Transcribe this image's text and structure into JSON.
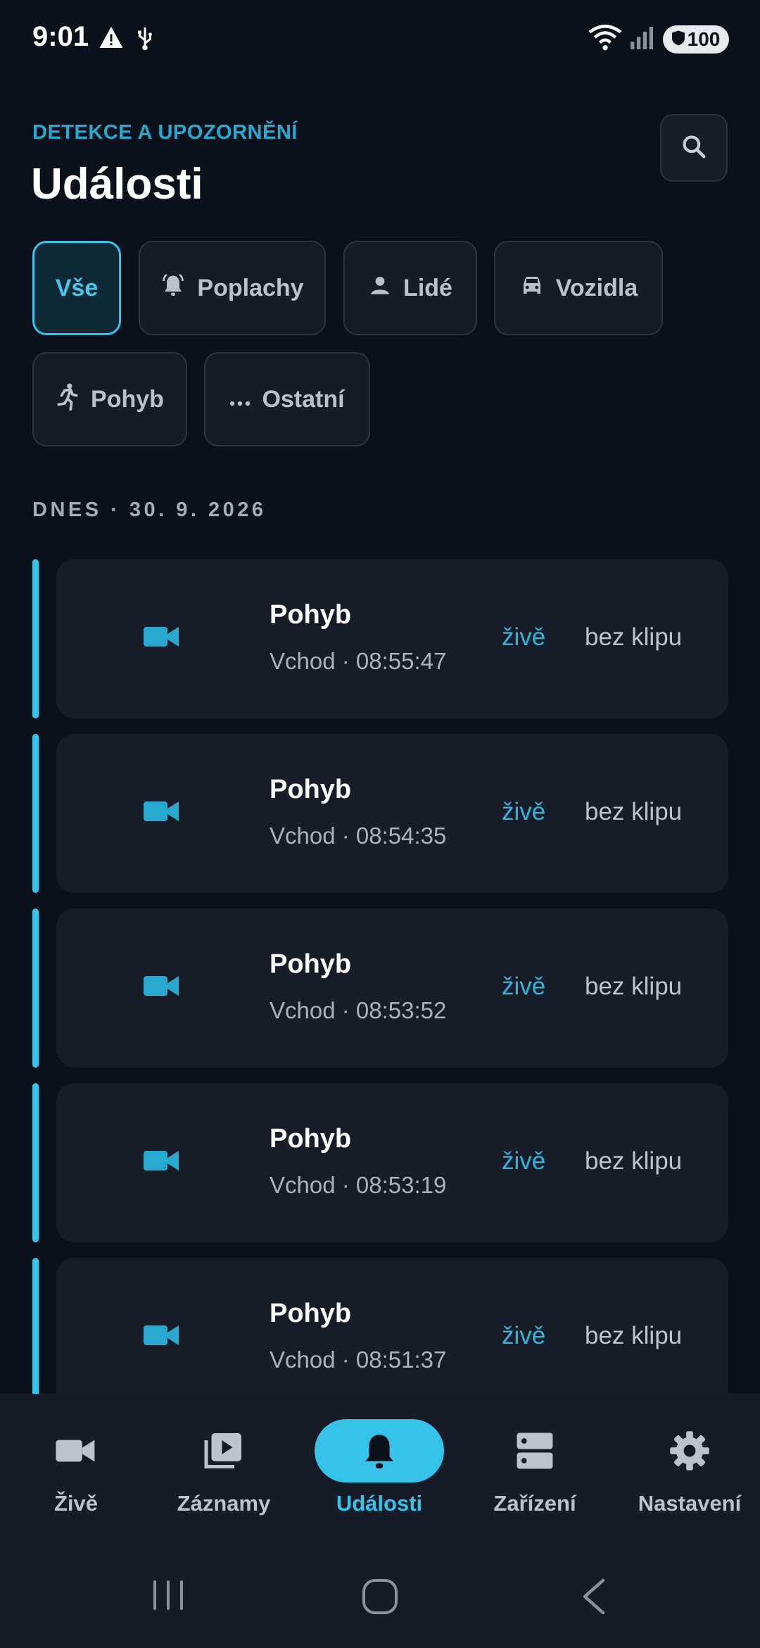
{
  "status_bar": {
    "time": "9:01",
    "battery": "100",
    "icons": [
      "warning-icon",
      "usb-icon",
      "wifi-icon",
      "signal-icon",
      "battery-icon"
    ]
  },
  "header": {
    "eyebrow": "DETEKCE A UPOZORNĚNÍ",
    "title": "Události",
    "search_icon": "search-icon"
  },
  "filters": [
    {
      "label": "Vše",
      "icon": "",
      "active": true
    },
    {
      "label": "Poplachy",
      "icon": "alarm-bell-icon",
      "active": false
    },
    {
      "label": "Lidé",
      "icon": "person-icon",
      "active": false
    },
    {
      "label": "Vozidla",
      "icon": "car-icon",
      "active": false
    },
    {
      "label": "Pohyb",
      "icon": "running-person-icon",
      "active": false
    },
    {
      "label": "Ostatní",
      "icon": "more-dots-icon",
      "active": false
    }
  ],
  "date_label": "DNES · 30. 9. 2026",
  "events": [
    {
      "title": "Pohyb",
      "subtitle": "Vchod · 08:55:47",
      "live": "živě",
      "clip": "bez klipu",
      "icon": "video-camera-icon"
    },
    {
      "title": "Pohyb",
      "subtitle": "Vchod · 08:54:35",
      "live": "živě",
      "clip": "bez klipu",
      "icon": "video-camera-icon"
    },
    {
      "title": "Pohyb",
      "subtitle": "Vchod · 08:53:52",
      "live": "živě",
      "clip": "bez klipu",
      "icon": "video-camera-icon"
    },
    {
      "title": "Pohyb",
      "subtitle": "Vchod · 08:53:19",
      "live": "živě",
      "clip": "bez klipu",
      "icon": "video-camera-icon"
    },
    {
      "title": "Pohyb",
      "subtitle": "Vchod · 08:51:37",
      "live": "živě",
      "clip": "bez klipu",
      "icon": "video-camera-icon"
    }
  ],
  "bottom_nav": [
    {
      "label": "Živě",
      "icon": "video-camera-icon",
      "active": false
    },
    {
      "label": "Záznamy",
      "icon": "recordings-icon",
      "active": false
    },
    {
      "label": "Události",
      "icon": "bell-icon",
      "active": true
    },
    {
      "label": "Zařízení",
      "icon": "devices-icon",
      "active": false
    },
    {
      "label": "Nastavení",
      "icon": "gear-icon",
      "active": false
    }
  ],
  "colors": {
    "background": "#0b111a",
    "accent": "#36c3ea",
    "card": "#161d29",
    "nav_background": "#151c28"
  }
}
